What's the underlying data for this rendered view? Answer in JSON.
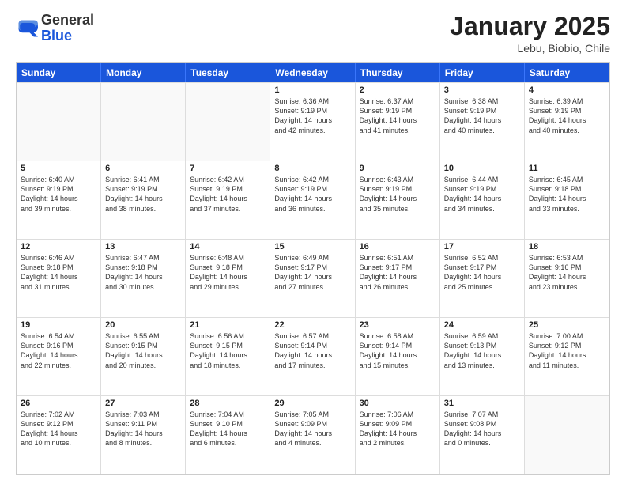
{
  "header": {
    "logo_general": "General",
    "logo_blue": "Blue",
    "title": "January 2025",
    "subtitle": "Lebu, Biobio, Chile"
  },
  "days_of_week": [
    "Sunday",
    "Monday",
    "Tuesday",
    "Wednesday",
    "Thursday",
    "Friday",
    "Saturday"
  ],
  "weeks": [
    [
      {
        "day": "",
        "info": ""
      },
      {
        "day": "",
        "info": ""
      },
      {
        "day": "",
        "info": ""
      },
      {
        "day": "1",
        "info": "Sunrise: 6:36 AM\nSunset: 9:19 PM\nDaylight: 14 hours\nand 42 minutes."
      },
      {
        "day": "2",
        "info": "Sunrise: 6:37 AM\nSunset: 9:19 PM\nDaylight: 14 hours\nand 41 minutes."
      },
      {
        "day": "3",
        "info": "Sunrise: 6:38 AM\nSunset: 9:19 PM\nDaylight: 14 hours\nand 40 minutes."
      },
      {
        "day": "4",
        "info": "Sunrise: 6:39 AM\nSunset: 9:19 PM\nDaylight: 14 hours\nand 40 minutes."
      }
    ],
    [
      {
        "day": "5",
        "info": "Sunrise: 6:40 AM\nSunset: 9:19 PM\nDaylight: 14 hours\nand 39 minutes."
      },
      {
        "day": "6",
        "info": "Sunrise: 6:41 AM\nSunset: 9:19 PM\nDaylight: 14 hours\nand 38 minutes."
      },
      {
        "day": "7",
        "info": "Sunrise: 6:42 AM\nSunset: 9:19 PM\nDaylight: 14 hours\nand 37 minutes."
      },
      {
        "day": "8",
        "info": "Sunrise: 6:42 AM\nSunset: 9:19 PM\nDaylight: 14 hours\nand 36 minutes."
      },
      {
        "day": "9",
        "info": "Sunrise: 6:43 AM\nSunset: 9:19 PM\nDaylight: 14 hours\nand 35 minutes."
      },
      {
        "day": "10",
        "info": "Sunrise: 6:44 AM\nSunset: 9:19 PM\nDaylight: 14 hours\nand 34 minutes."
      },
      {
        "day": "11",
        "info": "Sunrise: 6:45 AM\nSunset: 9:18 PM\nDaylight: 14 hours\nand 33 minutes."
      }
    ],
    [
      {
        "day": "12",
        "info": "Sunrise: 6:46 AM\nSunset: 9:18 PM\nDaylight: 14 hours\nand 31 minutes."
      },
      {
        "day": "13",
        "info": "Sunrise: 6:47 AM\nSunset: 9:18 PM\nDaylight: 14 hours\nand 30 minutes."
      },
      {
        "day": "14",
        "info": "Sunrise: 6:48 AM\nSunset: 9:18 PM\nDaylight: 14 hours\nand 29 minutes."
      },
      {
        "day": "15",
        "info": "Sunrise: 6:49 AM\nSunset: 9:17 PM\nDaylight: 14 hours\nand 27 minutes."
      },
      {
        "day": "16",
        "info": "Sunrise: 6:51 AM\nSunset: 9:17 PM\nDaylight: 14 hours\nand 26 minutes."
      },
      {
        "day": "17",
        "info": "Sunrise: 6:52 AM\nSunset: 9:17 PM\nDaylight: 14 hours\nand 25 minutes."
      },
      {
        "day": "18",
        "info": "Sunrise: 6:53 AM\nSunset: 9:16 PM\nDaylight: 14 hours\nand 23 minutes."
      }
    ],
    [
      {
        "day": "19",
        "info": "Sunrise: 6:54 AM\nSunset: 9:16 PM\nDaylight: 14 hours\nand 22 minutes."
      },
      {
        "day": "20",
        "info": "Sunrise: 6:55 AM\nSunset: 9:15 PM\nDaylight: 14 hours\nand 20 minutes."
      },
      {
        "day": "21",
        "info": "Sunrise: 6:56 AM\nSunset: 9:15 PM\nDaylight: 14 hours\nand 18 minutes."
      },
      {
        "day": "22",
        "info": "Sunrise: 6:57 AM\nSunset: 9:14 PM\nDaylight: 14 hours\nand 17 minutes."
      },
      {
        "day": "23",
        "info": "Sunrise: 6:58 AM\nSunset: 9:14 PM\nDaylight: 14 hours\nand 15 minutes."
      },
      {
        "day": "24",
        "info": "Sunrise: 6:59 AM\nSunset: 9:13 PM\nDaylight: 14 hours\nand 13 minutes."
      },
      {
        "day": "25",
        "info": "Sunrise: 7:00 AM\nSunset: 9:12 PM\nDaylight: 14 hours\nand 11 minutes."
      }
    ],
    [
      {
        "day": "26",
        "info": "Sunrise: 7:02 AM\nSunset: 9:12 PM\nDaylight: 14 hours\nand 10 minutes."
      },
      {
        "day": "27",
        "info": "Sunrise: 7:03 AM\nSunset: 9:11 PM\nDaylight: 14 hours\nand 8 minutes."
      },
      {
        "day": "28",
        "info": "Sunrise: 7:04 AM\nSunset: 9:10 PM\nDaylight: 14 hours\nand 6 minutes."
      },
      {
        "day": "29",
        "info": "Sunrise: 7:05 AM\nSunset: 9:09 PM\nDaylight: 14 hours\nand 4 minutes."
      },
      {
        "day": "30",
        "info": "Sunrise: 7:06 AM\nSunset: 9:09 PM\nDaylight: 14 hours\nand 2 minutes."
      },
      {
        "day": "31",
        "info": "Sunrise: 7:07 AM\nSunset: 9:08 PM\nDaylight: 14 hours\nand 0 minutes."
      },
      {
        "day": "",
        "info": ""
      }
    ]
  ]
}
